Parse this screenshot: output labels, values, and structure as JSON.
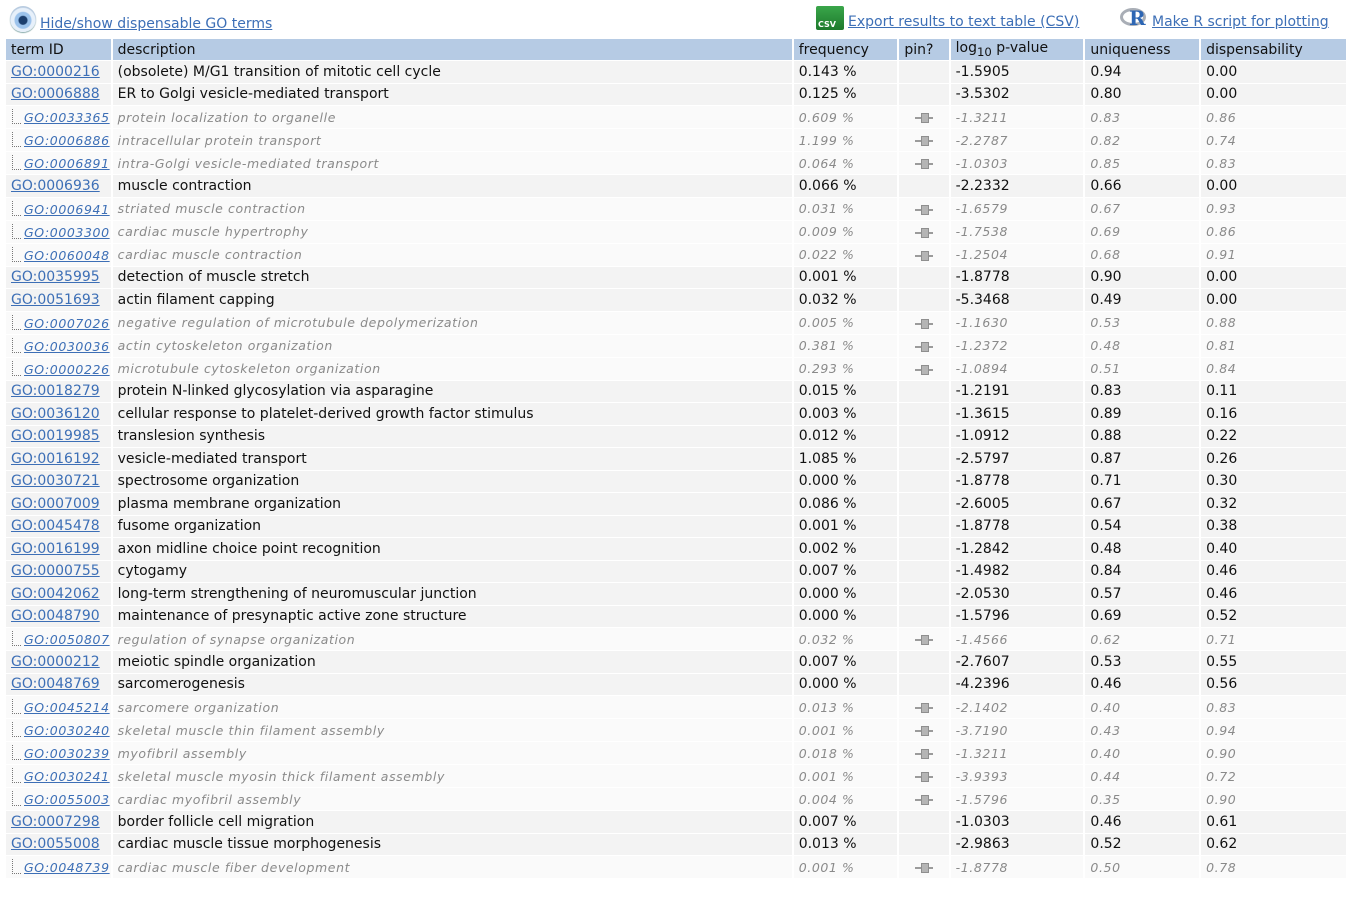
{
  "toolbar": {
    "hide_show_label": "Hide/show dispensable GO terms",
    "export_label": "Export results to text table (CSV)",
    "r_script_label": "Make R script for plotting"
  },
  "columns": [
    "term ID",
    "description",
    "frequency",
    "pin?",
    "log",
    "10",
    "p-value",
    "uniqueness",
    "dispensability"
  ],
  "rows": [
    {
      "id": "GO:0000216",
      "desc": "(obsolete) M/G1 transition of mitotic cell cycle",
      "freq": "0.143 %",
      "p": "-1.5905",
      "uniq": "0.94",
      "disp": "0.00",
      "dispensable": false
    },
    {
      "id": "GO:0006888",
      "desc": "ER to Golgi vesicle-mediated transport",
      "freq": "0.125 %",
      "p": "-3.5302",
      "uniq": "0.80",
      "disp": "0.00",
      "dispensable": false
    },
    {
      "id": "GO:0033365",
      "desc": "protein localization to organelle",
      "freq": "0.609 %",
      "p": "-1.3211",
      "uniq": "0.83",
      "disp": "0.86",
      "dispensable": true
    },
    {
      "id": "GO:0006886",
      "desc": "intracellular protein transport",
      "freq": "1.199 %",
      "p": "-2.2787",
      "uniq": "0.82",
      "disp": "0.74",
      "dispensable": true
    },
    {
      "id": "GO:0006891",
      "desc": "intra-Golgi vesicle-mediated transport",
      "freq": "0.064 %",
      "p": "-1.0303",
      "uniq": "0.85",
      "disp": "0.83",
      "dispensable": true
    },
    {
      "id": "GO:0006936",
      "desc": "muscle contraction",
      "freq": "0.066 %",
      "p": "-2.2332",
      "uniq": "0.66",
      "disp": "0.00",
      "dispensable": false
    },
    {
      "id": "GO:0006941",
      "desc": "striated muscle contraction",
      "freq": "0.031 %",
      "p": "-1.6579",
      "uniq": "0.67",
      "disp": "0.93",
      "dispensable": true
    },
    {
      "id": "GO:0003300",
      "desc": "cardiac muscle hypertrophy",
      "freq": "0.009 %",
      "p": "-1.7538",
      "uniq": "0.69",
      "disp": "0.86",
      "dispensable": true
    },
    {
      "id": "GO:0060048",
      "desc": "cardiac muscle contraction",
      "freq": "0.022 %",
      "p": "-1.2504",
      "uniq": "0.68",
      "disp": "0.91",
      "dispensable": true
    },
    {
      "id": "GO:0035995",
      "desc": "detection of muscle stretch",
      "freq": "0.001 %",
      "p": "-1.8778",
      "uniq": "0.90",
      "disp": "0.00",
      "dispensable": false
    },
    {
      "id": "GO:0051693",
      "desc": "actin filament capping",
      "freq": "0.032 %",
      "p": "-5.3468",
      "uniq": "0.49",
      "disp": "0.00",
      "dispensable": false
    },
    {
      "id": "GO:0007026",
      "desc": "negative regulation of microtubule depolymerization",
      "freq": "0.005 %",
      "p": "-1.1630",
      "uniq": "0.53",
      "disp": "0.88",
      "dispensable": true
    },
    {
      "id": "GO:0030036",
      "desc": "actin cytoskeleton organization",
      "freq": "0.381 %",
      "p": "-1.2372",
      "uniq": "0.48",
      "disp": "0.81",
      "dispensable": true
    },
    {
      "id": "GO:0000226",
      "desc": "microtubule cytoskeleton organization",
      "freq": "0.293 %",
      "p": "-1.0894",
      "uniq": "0.51",
      "disp": "0.84",
      "dispensable": true
    },
    {
      "id": "GO:0018279",
      "desc": "protein N-linked glycosylation via asparagine",
      "freq": "0.015 %",
      "p": "-1.2191",
      "uniq": "0.83",
      "disp": "0.11",
      "dispensable": false
    },
    {
      "id": "GO:0036120",
      "desc": "cellular response to platelet-derived growth factor stimulus",
      "freq": "0.003 %",
      "p": "-1.3615",
      "uniq": "0.89",
      "disp": "0.16",
      "dispensable": false
    },
    {
      "id": "GO:0019985",
      "desc": "translesion synthesis",
      "freq": "0.012 %",
      "p": "-1.0912",
      "uniq": "0.88",
      "disp": "0.22",
      "dispensable": false
    },
    {
      "id": "GO:0016192",
      "desc": "vesicle-mediated transport",
      "freq": "1.085 %",
      "p": "-2.5797",
      "uniq": "0.87",
      "disp": "0.26",
      "dispensable": false
    },
    {
      "id": "GO:0030721",
      "desc": "spectrosome organization",
      "freq": "0.000 %",
      "p": "-1.8778",
      "uniq": "0.71",
      "disp": "0.30",
      "dispensable": false
    },
    {
      "id": "GO:0007009",
      "desc": "plasma membrane organization",
      "freq": "0.086 %",
      "p": "-2.6005",
      "uniq": "0.67",
      "disp": "0.32",
      "dispensable": false
    },
    {
      "id": "GO:0045478",
      "desc": "fusome organization",
      "freq": "0.001 %",
      "p": "-1.8778",
      "uniq": "0.54",
      "disp": "0.38",
      "dispensable": false
    },
    {
      "id": "GO:0016199",
      "desc": "axon midline choice point recognition",
      "freq": "0.002 %",
      "p": "-1.2842",
      "uniq": "0.48",
      "disp": "0.40",
      "dispensable": false
    },
    {
      "id": "GO:0000755",
      "desc": "cytogamy",
      "freq": "0.007 %",
      "p": "-1.4982",
      "uniq": "0.84",
      "disp": "0.46",
      "dispensable": false
    },
    {
      "id": "GO:0042062",
      "desc": "long-term strengthening of neuromuscular junction",
      "freq": "0.000 %",
      "p": "-2.0530",
      "uniq": "0.57",
      "disp": "0.46",
      "dispensable": false
    },
    {
      "id": "GO:0048790",
      "desc": "maintenance of presynaptic active zone structure",
      "freq": "0.000 %",
      "p": "-1.5796",
      "uniq": "0.69",
      "disp": "0.52",
      "dispensable": false
    },
    {
      "id": "GO:0050807",
      "desc": "regulation of synapse organization",
      "freq": "0.032 %",
      "p": "-1.4566",
      "uniq": "0.62",
      "disp": "0.71",
      "dispensable": true
    },
    {
      "id": "GO:0000212",
      "desc": "meiotic spindle organization",
      "freq": "0.007 %",
      "p": "-2.7607",
      "uniq": "0.53",
      "disp": "0.55",
      "dispensable": false
    },
    {
      "id": "GO:0048769",
      "desc": "sarcomerogenesis",
      "freq": "0.000 %",
      "p": "-4.2396",
      "uniq": "0.46",
      "disp": "0.56",
      "dispensable": false
    },
    {
      "id": "GO:0045214",
      "desc": "sarcomere organization",
      "freq": "0.013 %",
      "p": "-2.1402",
      "uniq": "0.40",
      "disp": "0.83",
      "dispensable": true
    },
    {
      "id": "GO:0030240",
      "desc": "skeletal muscle thin filament assembly",
      "freq": "0.001 %",
      "p": "-3.7190",
      "uniq": "0.43",
      "disp": "0.94",
      "dispensable": true
    },
    {
      "id": "GO:0030239",
      "desc": "myofibril assembly",
      "freq": "0.018 %",
      "p": "-1.3211",
      "uniq": "0.40",
      "disp": "0.90",
      "dispensable": true
    },
    {
      "id": "GO:0030241",
      "desc": "skeletal muscle myosin thick filament assembly",
      "freq": "0.001 %",
      "p": "-3.9393",
      "uniq": "0.44",
      "disp": "0.72",
      "dispensable": true
    },
    {
      "id": "GO:0055003",
      "desc": "cardiac myofibril assembly",
      "freq": "0.004 %",
      "p": "-1.5796",
      "uniq": "0.35",
      "disp": "0.90",
      "dispensable": true
    },
    {
      "id": "GO:0007298",
      "desc": "border follicle cell migration",
      "freq": "0.007 %",
      "p": "-1.0303",
      "uniq": "0.46",
      "disp": "0.61",
      "dispensable": false
    },
    {
      "id": "GO:0055008",
      "desc": "cardiac muscle tissue morphogenesis",
      "freq": "0.013 %",
      "p": "-2.9863",
      "uniq": "0.52",
      "disp": "0.62",
      "dispensable": false
    },
    {
      "id": "GO:0048739",
      "desc": "cardiac muscle fiber development",
      "freq": "0.001 %",
      "p": "-1.8778",
      "uniq": "0.50",
      "disp": "0.78",
      "dispensable": true
    }
  ]
}
